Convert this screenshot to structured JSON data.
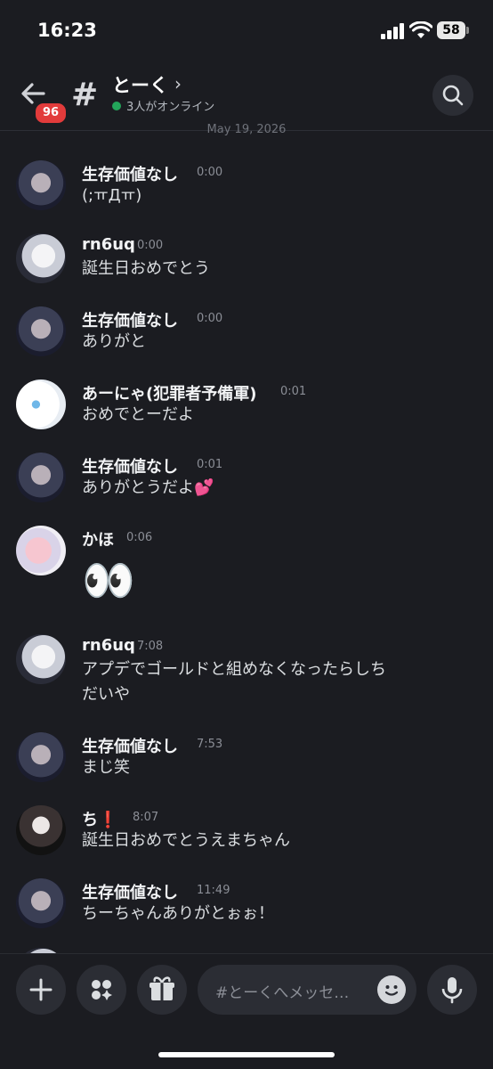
{
  "status_bar": {
    "time": "16:23",
    "battery": "58"
  },
  "header": {
    "unread_badge": "96",
    "channel_name": "とーく",
    "online_text": "3人がオンライン"
  },
  "date_separator": "May 19, 2026",
  "messages": [
    {
      "user": "生存価値なし",
      "time": "0:00",
      "text": "(;ㅠДㅠ)"
    },
    {
      "user": "rn6uq",
      "time": "0:00",
      "text": "誕生日おめでとう"
    },
    {
      "user": "生存価値なし",
      "time": "0:00",
      "text": "ありがと"
    },
    {
      "user": "あーにゃ(犯罪者予備軍)",
      "time": "0:01",
      "text": "おめでとーだよ"
    },
    {
      "user": "生存価値なし",
      "time": "0:01",
      "text": "ありがとうだよ💕"
    },
    {
      "user": "かほ",
      "time": "0:06",
      "text": "👀"
    },
    {
      "user": "rn6uq",
      "time": "7:08",
      "text": "アプデでゴールドと組めなくなったらしち\nだいや"
    },
    {
      "user": "生存価値なし",
      "time": "7:53",
      "text": "まじ笑"
    },
    {
      "user": "ち❗️",
      "time": "8:07",
      "text": "誕生日おめでとうえまちゃん"
    },
    {
      "user": "生存価値なし",
      "time": "11:49",
      "text": "ちーちゃんありがとぉぉ！"
    }
  ],
  "composer": {
    "placeholder": "#とーくへメッセ…"
  },
  "colors": {
    "background": "#1b1c21",
    "online": "#23a55a",
    "badge": "#e23b3b"
  }
}
